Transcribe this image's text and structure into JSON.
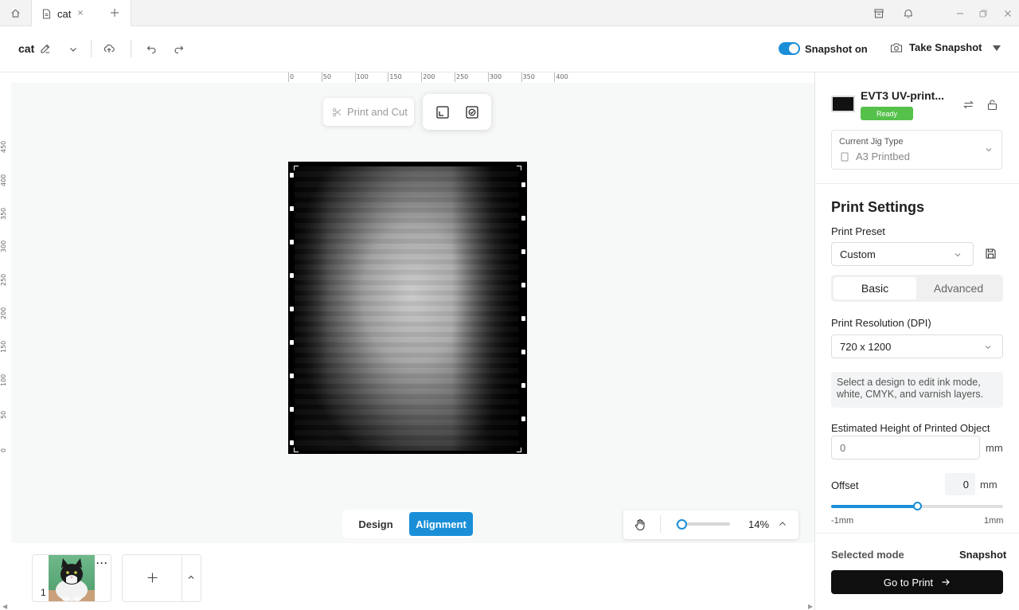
{
  "window": {
    "tab_title": "cat",
    "icons": [
      "home-icon",
      "file-icon",
      "close-icon",
      "plus-icon",
      "archive-icon",
      "bell-icon",
      "minimize-icon",
      "restore-icon",
      "close-window-icon"
    ]
  },
  "toolbar": {
    "doc_title": "cat",
    "snapshot_toggle_label": "Snapshot on",
    "snapshot_toggle_on": true,
    "take_snapshot_label": "Take Snapshot"
  },
  "canvas": {
    "ruler_top": [
      "0",
      "50",
      "100",
      "150",
      "200",
      "250",
      "300",
      "350",
      "400"
    ],
    "ruler_left": [
      "450",
      "400",
      "350",
      "300",
      "250",
      "200",
      "150",
      "100",
      "50",
      "0"
    ],
    "print_and_cut_label": "Print and Cut",
    "mode_design": "Design",
    "mode_alignment": "Alignment",
    "zoom_value": "14%",
    "zoom_fraction": 0.14
  },
  "pages": {
    "thumb_number": "1",
    "thumb_more": "···"
  },
  "device": {
    "name": "EVT3 UV-print...",
    "status": "Ready",
    "jig_label": "Current Jig Type",
    "jig_value": "A3 Printbed"
  },
  "print_settings": {
    "title": "Print Settings",
    "preset_label": "Print Preset",
    "preset_value": "Custom",
    "tab_basic": "Basic",
    "tab_advanced": "Advanced",
    "resolution_label": "Print Resolution (DPI)",
    "resolution_value": "720 x 1200",
    "info_text": "Select a design to edit ink mode, white, CMYK, and varnish layers.",
    "height_label": "Estimated Height of Printed Object",
    "height_placeholder": "0",
    "height_unit": "mm",
    "offset_label": "Offset",
    "offset_value": "0",
    "offset_unit": "mm",
    "offset_min": "-1mm",
    "offset_max": "1mm",
    "offset_fraction": 0.5
  },
  "footer": {
    "selected_mode_label": "Selected mode",
    "selected_mode_value": "Snapshot",
    "go_to_print_label": "Go to Print"
  },
  "colors": {
    "accent": "#1a8fd8",
    "ready_green": "#55c14b"
  }
}
